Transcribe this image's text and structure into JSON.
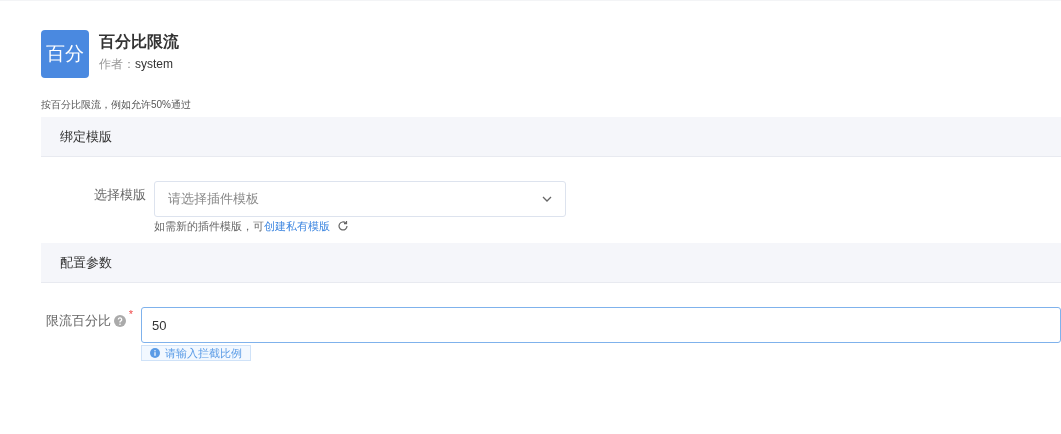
{
  "plugin": {
    "icon_text": "百分",
    "title": "百分比限流",
    "author_label": "作者：",
    "author": "system",
    "description": "按百分比限流，例如允许50%通过"
  },
  "sections": [
    {
      "title": "绑定模版",
      "fields": [
        {
          "kind": "select",
          "label": "选择模版",
          "required": false,
          "placeholder": "请选择插件模板",
          "hint": "如需新的插件模版，可",
          "hint_link": "创建私有模版"
        }
      ]
    },
    {
      "title": "配置参数",
      "fields": [
        {
          "kind": "input",
          "label": "限流百分比",
          "required": true,
          "required_mark": "*",
          "value": "50",
          "focused": true,
          "tip": "请输入拦截比例"
        }
      ]
    }
  ]
}
